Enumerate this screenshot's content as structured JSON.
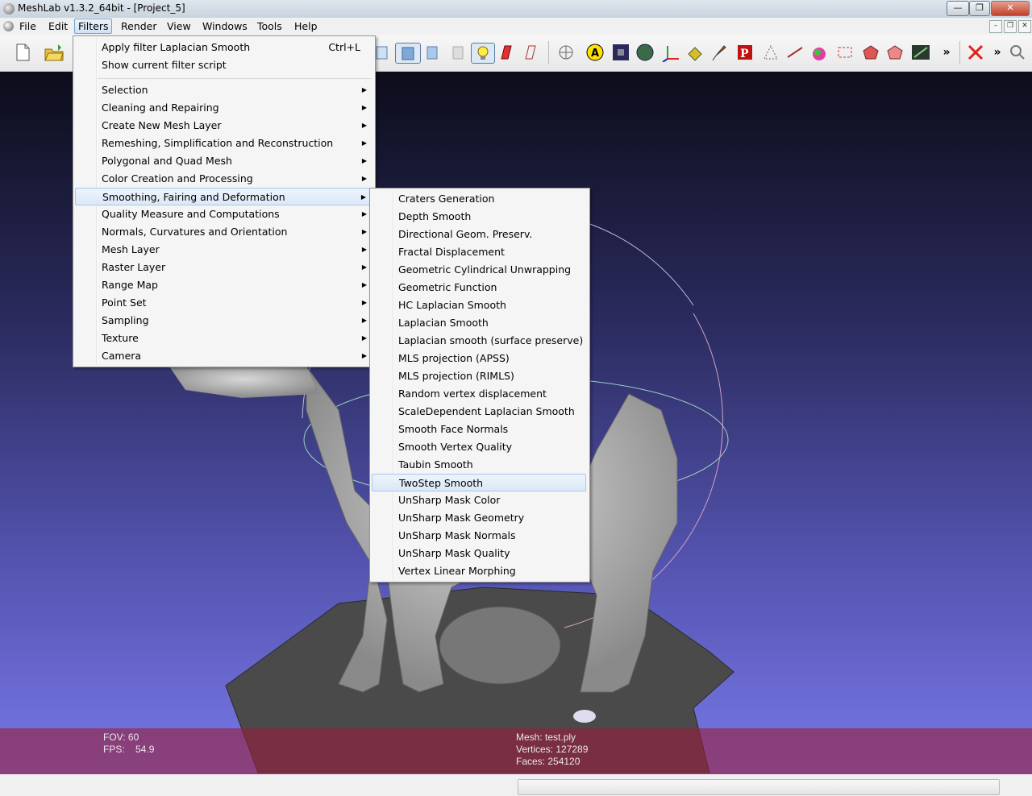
{
  "window": {
    "title": "MeshLab v1.3.2_64bit - [Project_5]",
    "minimize": "—",
    "maximize": "❐",
    "close": "✕"
  },
  "menubar": [
    "File",
    "Edit",
    "Filters",
    "Render",
    "View",
    "Windows",
    "Tools",
    "Help"
  ],
  "mdi_buttons": [
    "–",
    "❐",
    "✕"
  ],
  "toolbar": {
    "more_left": "»",
    "more_right": "»"
  },
  "filters_menu": {
    "top_items": [
      {
        "label": "Apply filter Laplacian Smooth",
        "shortcut": "Ctrl+L"
      },
      {
        "label": "Show current filter script",
        "shortcut": ""
      }
    ],
    "items": [
      "Selection",
      "Cleaning and Repairing",
      "Create New Mesh Layer",
      "Remeshing, Simplification and Reconstruction",
      "Polygonal and Quad Mesh",
      "Color Creation and Processing",
      "Smoothing, Fairing and Deformation",
      "Quality Measure and Computations",
      "Normals, Curvatures and Orientation",
      "Mesh Layer",
      "Raster Layer",
      "Range Map",
      "Point Set",
      "Sampling",
      "Texture",
      "Camera"
    ],
    "arrow": "▶"
  },
  "submenu": {
    "items": [
      "Craters Generation",
      "Depth Smooth",
      "Directional Geom. Preserv.",
      "Fractal Displacement",
      "Geometric Cylindrical Unwrapping",
      "Geometric Function",
      "HC Laplacian Smooth",
      "Laplacian Smooth",
      "Laplacian smooth (surface preserve)",
      "MLS projection (APSS)",
      "MLS projection (RIMLS)",
      "Random vertex displacement",
      "ScaleDependent Laplacian Smooth",
      "Smooth Face Normals",
      "Smooth Vertex Quality",
      "Taubin Smooth",
      "TwoStep Smooth",
      "UnSharp Mask Color",
      "UnSharp Mask Geometry",
      "UnSharp Mask Normals",
      "UnSharp Mask Quality",
      "Vertex Linear Morphing"
    ]
  },
  "info": {
    "fov": "FOV: 60",
    "fps": "FPS:    54.9",
    "mesh": "Mesh: test.ply",
    "vertices": "Vertices: 127289",
    "faces": "Faces: 254120"
  },
  "colors": {
    "accent": "#a8c6ea",
    "info_band": "#96203c",
    "viewport_top": "#0c0c1a",
    "viewport_bottom": "#7878e8"
  }
}
